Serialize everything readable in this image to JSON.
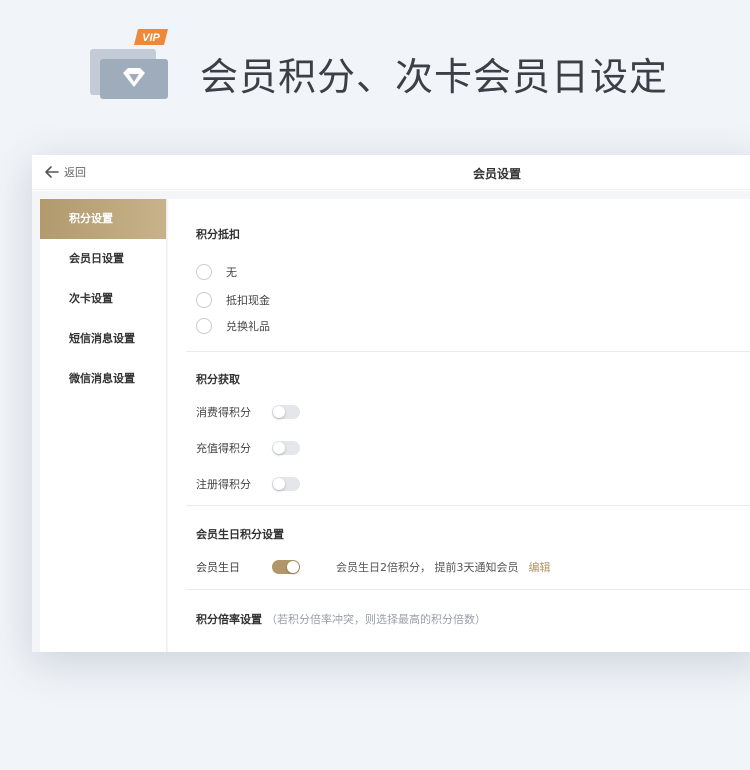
{
  "hero": {
    "badge": "VIP",
    "title": "会员积分、次卡会员日设定"
  },
  "header": {
    "back_label": "返回",
    "title": "会员设置"
  },
  "sidebar": {
    "items": [
      {
        "label": "积分设置",
        "active": true
      },
      {
        "label": "会员日设置",
        "active": false
      },
      {
        "label": "次卡设置",
        "active": false
      },
      {
        "label": "短信消息设置",
        "active": false
      },
      {
        "label": "微信消息设置",
        "active": false
      }
    ]
  },
  "points_deduction": {
    "title": "积分抵扣",
    "options": [
      {
        "label": "无",
        "selected": false
      },
      {
        "label": "抵扣现金",
        "selected": false
      },
      {
        "label": "兑换礼品",
        "selected": false
      }
    ]
  },
  "points_earning": {
    "title": "积分获取",
    "rows": [
      {
        "label": "消费得积分",
        "on": false
      },
      {
        "label": "充值得积分",
        "on": false
      },
      {
        "label": "注册得积分",
        "on": false
      }
    ]
  },
  "birthday": {
    "title": "会员生日积分设置",
    "label": "会员生日",
    "on": true,
    "description": "会员生日2倍积分，  提前3天通知会员",
    "edit_label": "编辑"
  },
  "multiplier": {
    "title": "积分倍率设置",
    "note": "（若积分倍率冲突，则选择最高的积分倍数）"
  },
  "colors": {
    "accent": "#b09668",
    "icon_card_back": "#c3ccd6",
    "icon_card_front": "#9eacbb",
    "badge": "#f0883a"
  }
}
